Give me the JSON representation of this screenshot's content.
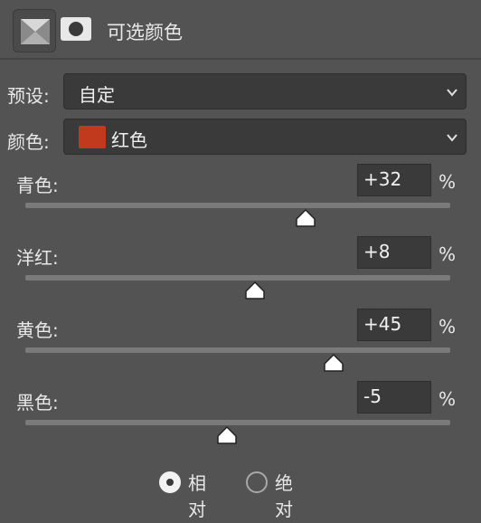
{
  "panel": {
    "title": "可选颜色",
    "icons": [
      "selective-color-adjustment-icon",
      "layer-mask-icon"
    ]
  },
  "preset": {
    "label": "预设:",
    "value": "自定"
  },
  "color": {
    "label": "颜色:",
    "value": "红色",
    "swatch_color": "#c23a1e"
  },
  "sliders": [
    {
      "label": "青色:",
      "value": "+32",
      "unit": "%",
      "level": 32
    },
    {
      "label": "洋红:",
      "value": "+8",
      "unit": "%",
      "level": 8
    },
    {
      "label": "黄色:",
      "value": "+45",
      "unit": "%",
      "level": 45
    },
    {
      "label": "黑色:",
      "value": "-5",
      "unit": "%",
      "level": -5
    }
  ],
  "method": {
    "options": [
      {
        "label": "相对",
        "selected": true
      },
      {
        "label": "绝对",
        "selected": false
      }
    ]
  }
}
